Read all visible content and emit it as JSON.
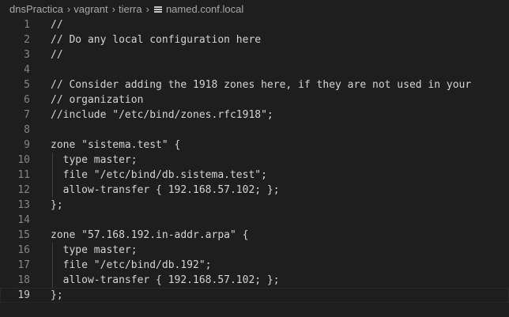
{
  "breadcrumb": {
    "items": [
      "dnsPractica",
      "vagrant",
      "tierra"
    ],
    "file": "named.conf.local"
  },
  "editor": {
    "current_line": 19,
    "lines": [
      {
        "n": "1",
        "text": "//"
      },
      {
        "n": "2",
        "text": "// Do any local configuration here"
      },
      {
        "n": "3",
        "text": "//"
      },
      {
        "n": "4",
        "text": ""
      },
      {
        "n": "5",
        "text": "// Consider adding the 1918 zones here, if they are not used in your"
      },
      {
        "n": "6",
        "text": "// organization"
      },
      {
        "n": "7",
        "text": "//include \"/etc/bind/zones.rfc1918\";"
      },
      {
        "n": "8",
        "text": ""
      },
      {
        "n": "9",
        "text": "zone \"sistema.test\" {"
      },
      {
        "n": "10",
        "text": "  type master;"
      },
      {
        "n": "11",
        "text": "  file \"/etc/bind/db.sistema.test\";"
      },
      {
        "n": "12",
        "text": "  allow-transfer { 192.168.57.102; };"
      },
      {
        "n": "13",
        "text": "};"
      },
      {
        "n": "14",
        "text": ""
      },
      {
        "n": "15",
        "text": "zone \"57.168.192.in-addr.arpa\" {"
      },
      {
        "n": "16",
        "text": "  type master;"
      },
      {
        "n": "17",
        "text": "  file \"/etc/bind/db.192\";"
      },
      {
        "n": "18",
        "text": "  allow-transfer { 192.168.57.102; };"
      },
      {
        "n": "19",
        "text": "};"
      }
    ]
  }
}
